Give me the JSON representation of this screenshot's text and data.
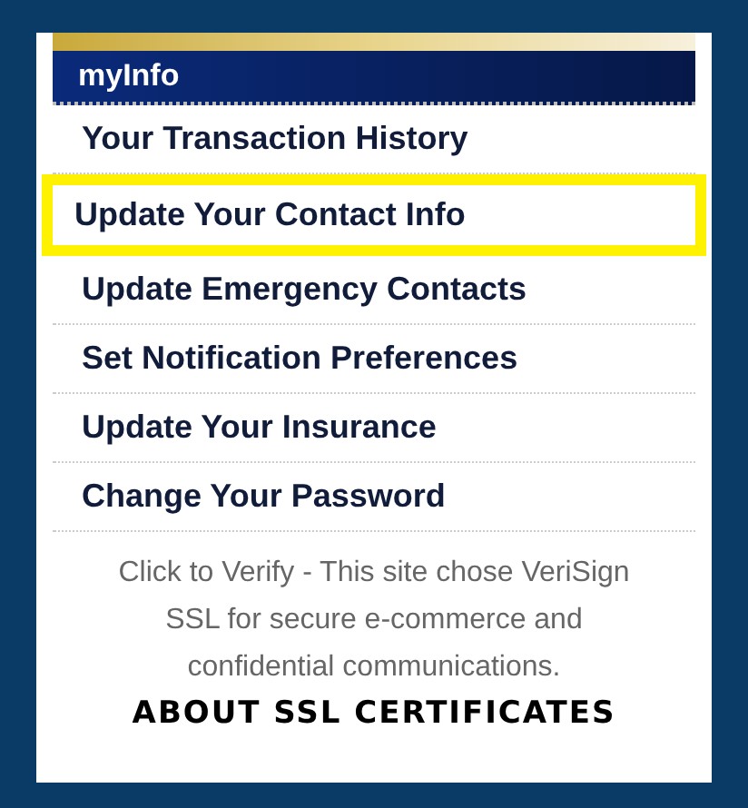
{
  "panel": {
    "title": "myInfo",
    "items": [
      {
        "label": "Your Transaction History",
        "highlighted": false
      },
      {
        "label": "Update Your Contact Info",
        "highlighted": true
      },
      {
        "label": "Update Emergency Contacts",
        "highlighted": false
      },
      {
        "label": "Set Notification Preferences",
        "highlighted": false
      },
      {
        "label": "Update Your Insurance",
        "highlighted": false
      },
      {
        "label": "Change Your Password",
        "highlighted": false
      }
    ],
    "ssl_notice": "Click to Verify - This site chose VeriSign SSL for secure e-commerce and confidential communications.",
    "ssl_link": "ABOUT SSL CERTIFICATES"
  }
}
